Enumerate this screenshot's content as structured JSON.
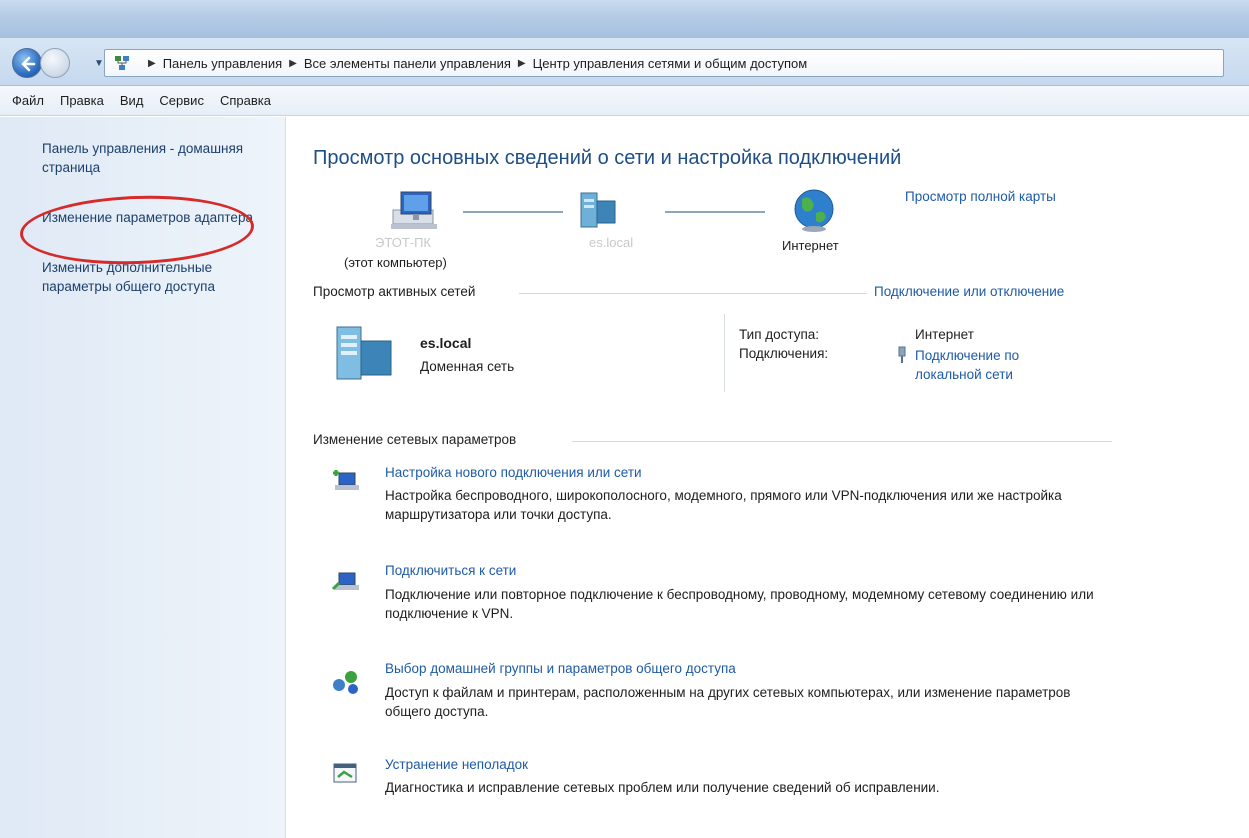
{
  "address_bar": {
    "crumbs": [
      "Панель управления",
      "Все элементы панели управления",
      "Центр управления сетями и общим доступом"
    ]
  },
  "menu": [
    "Файл",
    "Правка",
    "Вид",
    "Сервис",
    "Справка"
  ],
  "left_nav": {
    "home": "Панель управления - домашняя страница",
    "adapter": "Изменение параметров адаптера",
    "sharing": "Изменить дополнительные параметры общего доступа"
  },
  "main": {
    "title": "Просмотр основных сведений о сети и настройка подключений",
    "full_map_link": "Просмотр полной карты",
    "map": {
      "pc_name": "ЭТОТ-ПК",
      "pc_sub": "(этот компьютер)",
      "server_name": "es.local",
      "internet": "Интернет"
    },
    "active_networks_head": "Просмотр активных сетей",
    "connect_link": "Подключение или отключение",
    "network": {
      "name": "es.local",
      "type": "Доменная сеть",
      "access_label": "Тип доступа:",
      "access_value": "Интернет",
      "connections_label": "Подключения:",
      "connections_value": "Подключение по локальной сети"
    },
    "change_head": "Изменение сетевых параметров",
    "tasks": [
      {
        "title": "Настройка нового подключения или сети",
        "desc": "Настройка беспроводного, широкополосного, модемного, прямого или VPN-подключения или же настройка маршрутизатора или точки доступа."
      },
      {
        "title": "Подключиться к сети",
        "desc": "Подключение или повторное подключение к беспроводному, проводному, модемному сетевому соединению или подключение к VPN."
      },
      {
        "title": "Выбор домашней группы и параметров общего доступа",
        "desc": "Доступ к файлам и принтерам, расположенным на других сетевых компьютерах, или изменение параметров общего доступа."
      },
      {
        "title": "Устранение неполадок",
        "desc": "Диагностика и исправление сетевых проблем или получение сведений об исправлении."
      }
    ]
  },
  "colors": {
    "link": "#1e5aa8",
    "title": "#1e4e87",
    "highlight": "#d62b2b"
  }
}
